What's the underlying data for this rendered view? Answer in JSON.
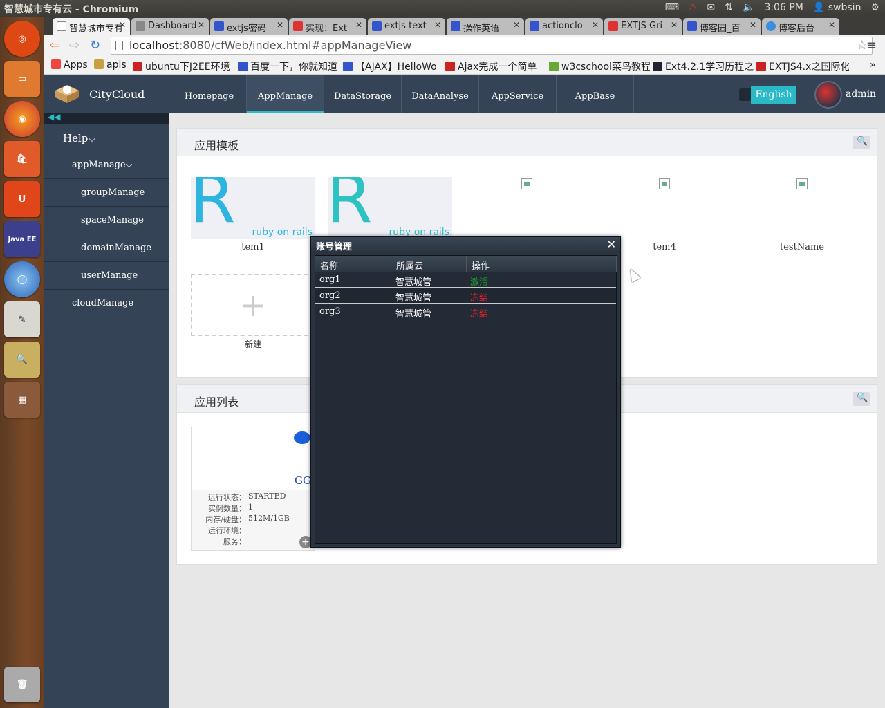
{
  "os": {
    "window_title": "智慧城市专有云 - Chromium",
    "clock": "3:06 PM",
    "user": "swbsin"
  },
  "browser": {
    "tabs": [
      {
        "label": "智慧城市专有",
        "active": true
      },
      {
        "label": "Dashboard"
      },
      {
        "label": "extjs密码"
      },
      {
        "label": "实现：Ext"
      },
      {
        "label": "extjs text"
      },
      {
        "label": "操作英语"
      },
      {
        "label": "actionclo"
      },
      {
        "label": "EXTJS Gri"
      },
      {
        "label": "博客园_百"
      },
      {
        "label": "博客后台"
      }
    ],
    "url_host": "localhost",
    "url_rest": ":8080/cfWeb/index.html#appManageView",
    "bookmarks": [
      "Apps",
      "apis",
      "ubuntu下J2EE环境",
      "百度一下，你就知道",
      "【AJAX】HelloWo",
      "Ajax完成一个简单",
      "w3cschool菜鸟教程",
      "Ext4.2.1学习历程之",
      "EXTJS4.x之国际化"
    ]
  },
  "header": {
    "brand": "CityCloud",
    "nav": [
      "Homepage",
      "AppManage",
      "DataStorage",
      "DataAnalyse",
      "AppService",
      "AppBase"
    ],
    "active_nav": "AppManage",
    "lang_button": "English",
    "user": "admin"
  },
  "sidebar": {
    "items": [
      {
        "label": "Help",
        "level": 0,
        "expanded": true
      },
      {
        "label": "appManage",
        "level": 1,
        "expanded": true
      },
      {
        "label": "groupManage",
        "level": 2
      },
      {
        "label": "spaceManage",
        "level": 2
      },
      {
        "label": "domainManage",
        "level": 2
      },
      {
        "label": "userManage",
        "level": 2
      },
      {
        "label": "cloudManage",
        "level": 1
      }
    ]
  },
  "templates_panel": {
    "title": "应用模板",
    "templates": [
      {
        "name": "tem1",
        "logo": "ruby on rails",
        "letter": "R"
      },
      {
        "name": "",
        "logo": "ruby on rails",
        "letter": "R"
      },
      {
        "name": ""
      },
      {
        "name": "tem4"
      },
      {
        "name": "testName"
      }
    ],
    "new_label": "新建"
  },
  "apps_panel": {
    "title": "应用列表",
    "app": {
      "name": "GG",
      "fields": [
        {
          "key": "运行状态：",
          "value": "STARTED"
        },
        {
          "key": "实例数量：",
          "value": "1"
        },
        {
          "key": "内存/硬盘：",
          "value": "512M/1GB"
        },
        {
          "key": "运行环境：",
          "value": ""
        },
        {
          "key": "服务：",
          "value": ""
        }
      ]
    }
  },
  "dialog": {
    "title": "账号管理",
    "columns": [
      "名称",
      "所属云",
      "操作"
    ],
    "rows": [
      {
        "name": "org1",
        "cloud": "智慧城管",
        "action": "激活",
        "status": "active"
      },
      {
        "name": "org2",
        "cloud": "智慧城管",
        "action": "冻结",
        "status": "frozen"
      },
      {
        "name": "org3",
        "cloud": "智慧城管",
        "action": "冻结",
        "status": "frozen"
      }
    ],
    "colors": {
      "active": "#1f9a2e",
      "frozen": "#e8202a"
    }
  }
}
